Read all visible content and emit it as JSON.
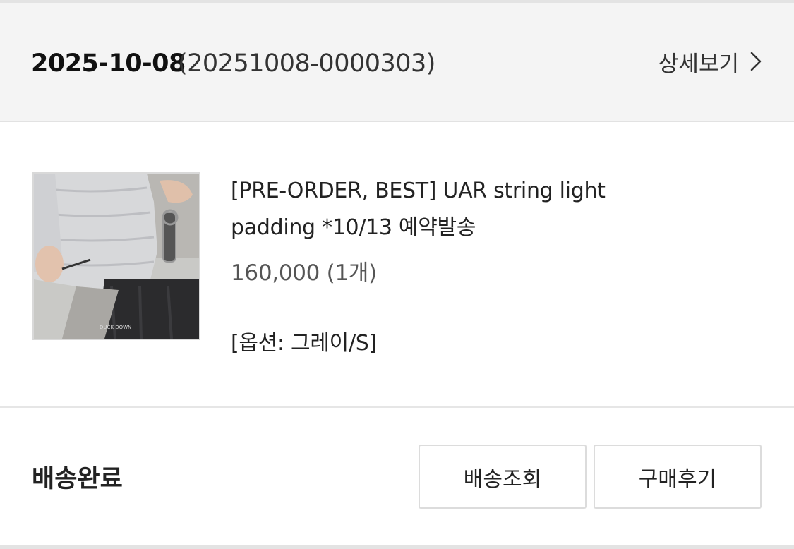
{
  "order": {
    "date": "2025-10-08",
    "number": "(20251008-0000303)",
    "details_label": "상세보기",
    "details_icon": "chevron-right-icon"
  },
  "product": {
    "name_line1": "[PRE-ORDER, BEST] UAR string light",
    "name_line2": "padding *10/13 예약발송",
    "price": "160,000 (1개)",
    "option": "[옵션: 그레이/S]",
    "thumbnail_caption": "DUCK DOWN"
  },
  "status": {
    "label": "배송완료",
    "track_button": "배송조회",
    "review_button": "구매후기"
  },
  "colors": {
    "header_bg": "#f4f4f4",
    "divider": "#e2e2e2",
    "text_primary": "#222222",
    "text_secondary": "#555555"
  }
}
